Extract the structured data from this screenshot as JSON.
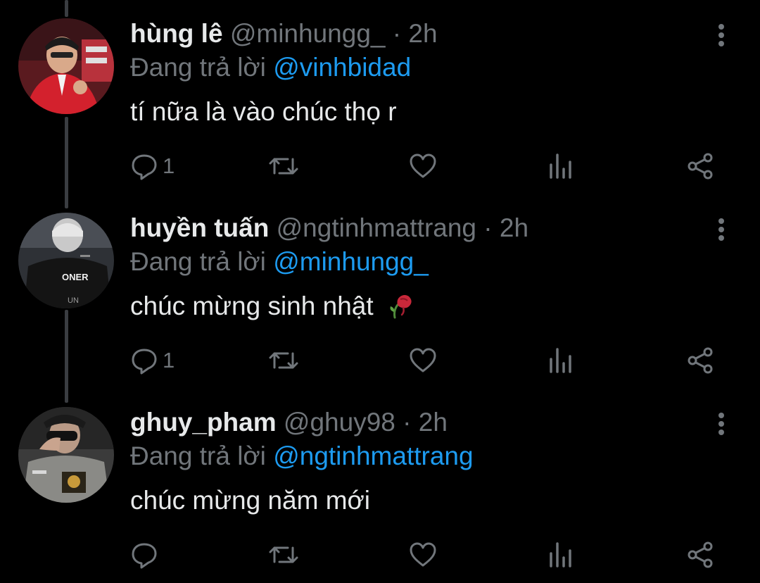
{
  "colors": {
    "background": "#000000",
    "primary_text": "#e7e9ea",
    "secondary_text": "#71767b",
    "accent": "#1d9bf0",
    "thread_line": "#3a3d41"
  },
  "tweets": [
    {
      "display_name": "hùng lê",
      "handle": "@minhungg_",
      "separator": "·",
      "time": "2h",
      "reply_prefix": "Đang trả lời",
      "reply_to": "@vinhbidad",
      "text": "tí nữa là vào chúc thọ r",
      "reply_count": "1",
      "avatar_icon": "avatar-red-jacket-player"
    },
    {
      "display_name": "huyền tuấn",
      "handle": "@ngtinhmattrang",
      "separator": "·",
      "time": "2h",
      "reply_prefix": "Đang trả lời",
      "reply_to": "@minhungg_",
      "text": "chúc mừng sinh nhật",
      "reply_count": "1",
      "avatar_icon": "avatar-oner-jersey",
      "emoji_icon": "wilted-rose-icon"
    },
    {
      "display_name": "ghuy_pham",
      "handle": "@ghuy98",
      "separator": "·",
      "time": "2h",
      "reply_prefix": "Đang trả lời",
      "reply_to": "@ngtinhmattrang",
      "text": "chúc mừng năm mới",
      "reply_count": "",
      "avatar_icon": "avatar-face-cover"
    }
  ]
}
